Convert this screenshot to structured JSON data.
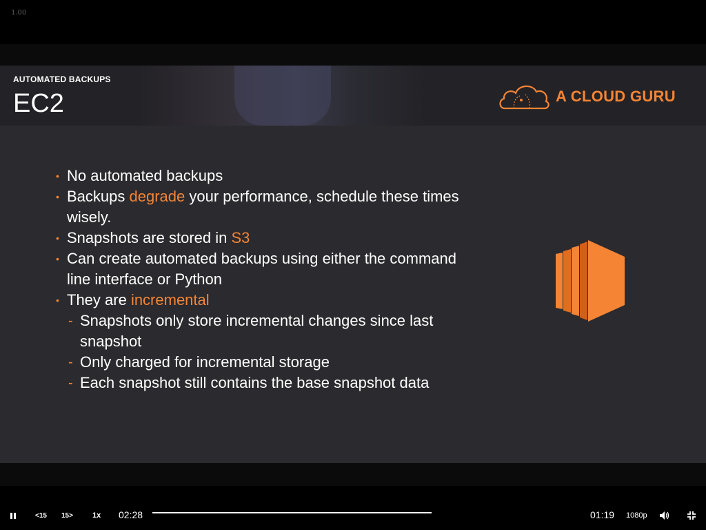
{
  "window": {
    "version": "1.00"
  },
  "slide": {
    "subtitle": "AUTOMATED BACKUPS",
    "title": "EC2",
    "logo_text": "A CLOUD GURU",
    "bullets": [
      {
        "parts": [
          "No automated backups"
        ]
      },
      {
        "parts": [
          "Backups ",
          "degrade",
          " your performance, schedule these times wisely."
        ]
      },
      {
        "parts": [
          "Snapshots are stored in ",
          "S3"
        ]
      },
      {
        "parts": [
          "Can create automated backups using either the command line interface or Python"
        ]
      },
      {
        "parts": [
          "They are ",
          "incremental"
        ]
      }
    ],
    "sub_bullets": [
      "Snapshots only store incremental changes since last snapshot",
      "Only charged for incremental storage",
      "Each snapshot still contains the base snapshot data"
    ],
    "accent_color": "#f58535"
  },
  "player": {
    "rewind_label": "15",
    "forward_label": "15",
    "speed_label": "1x",
    "time_current": "02:28",
    "time_remaining": "01:19",
    "quality_label": "1080p",
    "icons": [
      "pause-icon",
      "rewind-icon",
      "forward-icon",
      "volume-icon",
      "exit-fullscreen-icon"
    ]
  }
}
